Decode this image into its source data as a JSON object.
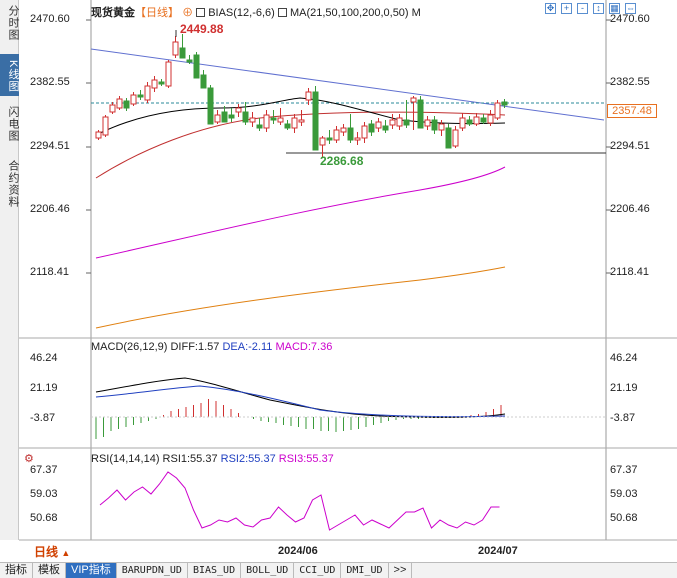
{
  "sidebar": {
    "tabs": [
      {
        "label": "分时图",
        "active": false
      },
      {
        "label": "K线图",
        "active": true
      },
      {
        "label": "闪电图",
        "active": false
      },
      {
        "label": "合约资料",
        "active": false
      }
    ]
  },
  "main_chart": {
    "symbol": "现货黄金",
    "period_tag": "【日线】",
    "indicator": "BIAS(12,-6,6)",
    "ma_label": "MA(21,50,100,200,0,50)",
    "ma_suffix": "M",
    "y_ticks": [
      "2470.60",
      "2382.55",
      "2294.51",
      "2206.46",
      "2118.41"
    ],
    "high_label": "2449.88",
    "low_label": "2286.68",
    "current_price": "2357.48"
  },
  "macd_panel": {
    "title": "MACD(26,12,9)",
    "diff": "DIFF:1.57",
    "dea": "DEA:-2.11",
    "macd": "MACD:7.36",
    "y_ticks": [
      "46.24",
      "21.19",
      "-3.87"
    ]
  },
  "rsi_panel": {
    "title": "RSI(14,14,14)",
    "rsi1": "RSI1:55.37",
    "rsi2": "RSI2:55.37",
    "rsi3": "RSI3:55.37",
    "y_ticks": [
      "67.37",
      "59.03",
      "50.68"
    ]
  },
  "date_axis": [
    "2024/06",
    "2024/07"
  ],
  "period_label": "日线",
  "bottom_tabs": [
    {
      "label": "指标",
      "active": false
    },
    {
      "label": "模板",
      "active": false
    },
    {
      "label": "VIP指标",
      "active": true
    },
    {
      "label": "BARUPDN_UD",
      "active": false
    },
    {
      "label": "BIAS_UD",
      "active": false
    },
    {
      "label": "BOLL_UD",
      "active": false
    },
    {
      "label": "CCI_UD",
      "active": false
    },
    {
      "label": "DMI_UD",
      "active": false
    },
    {
      "label": ">>",
      "active": false
    }
  ],
  "colors": {
    "up": "#d03030",
    "down": "#3a9a3a",
    "ma1": "#000000",
    "ma2": "#c03030",
    "ma3": "#cc00cc",
    "ma4": "#e08010",
    "trend": "#6070d0",
    "rsi": "#cc00cc"
  },
  "icons": [
    "move-left-icon",
    "zoom-in-icon",
    "zoom-out-icon",
    "expand-icon",
    "grid-icon",
    "scroll-icon"
  ]
}
